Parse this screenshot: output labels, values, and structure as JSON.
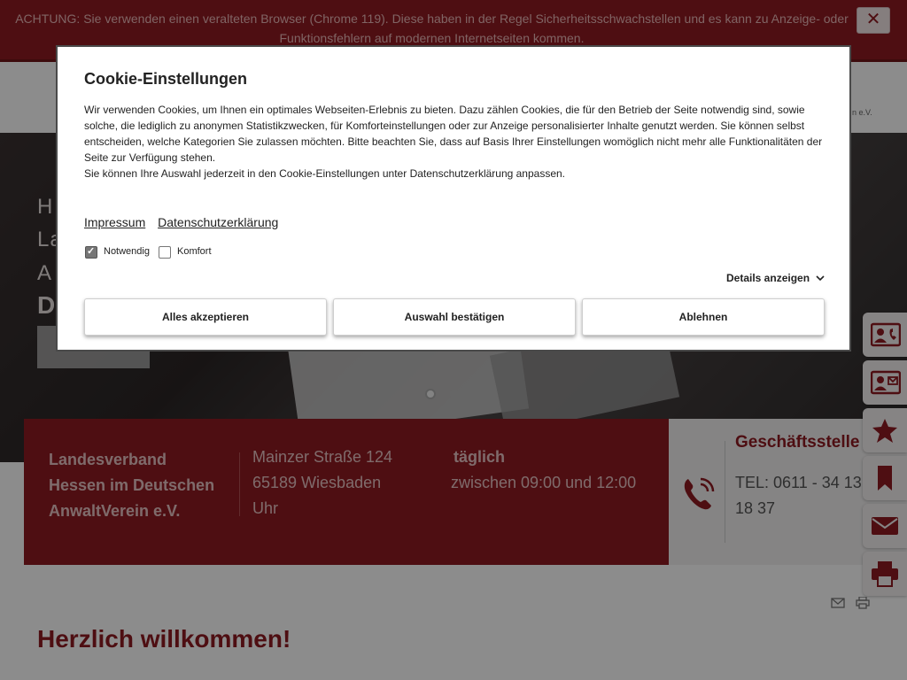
{
  "warning": {
    "text": "ACHTUNG: Sie verwenden einen veralteten Browser (Chrome 119). Diese haben in der Regel Sicherheitsschwachstellen und es kann zu Anzeige- oder Funktionsfehlern auf modernen Internetseiten kommen.",
    "close_label": "✕"
  },
  "header": {
    "logo_suffix": "n e.V."
  },
  "hero": {
    "lines": [
      "H",
      "La",
      "A",
      "D"
    ],
    "slider_dots": 3,
    "active_dot": 0
  },
  "info": {
    "org_lines": [
      "Landesverband",
      "Hessen im Deutschen",
      "AnwaltVerein e.V."
    ],
    "address_lines": [
      "Mainzer Straße 124",
      "65189 Wiesbaden"
    ],
    "hours_title": "täglich",
    "hours_lines": [
      "zwischen 09:00 und 12:00",
      "Uhr"
    ]
  },
  "contact": {
    "title": "Geschäftsstelle",
    "tel_lines": [
      "TEL: 0611 - 34 13",
      "18 37"
    ]
  },
  "rail": [
    {
      "icon": "phone-card-icon"
    },
    {
      "icon": "mail-card-icon"
    },
    {
      "icon": "star-icon"
    },
    {
      "icon": "bookmark-icon"
    },
    {
      "icon": "envelope-icon"
    },
    {
      "icon": "printer-icon"
    }
  ],
  "main": {
    "welcome": "Herzlich willkommen!"
  },
  "cookie": {
    "title": "Cookie-Einstellungen",
    "description": "Wir verwenden Cookies, um Ihnen ein optimales Webseiten-Erlebnis zu bieten. Dazu zählen Cookies, die für den Betrieb der Seite notwendig sind, sowie solche, die lediglich zu anonymen Statistikzwecken, für Komforteinstellungen oder zur Anzeige personalisierter Inhalte genutzt werden. Sie können selbst entscheiden, welche Kategorien Sie zulassen möchten. Bitte beachten Sie, dass auf Basis Ihrer Einstellungen womöglich nicht mehr alle Funktionalitäten der Seite zur Verfügung stehen.",
    "description2": "Sie können Ihre Auswahl jederzeit in den Cookie-Einstellungen unter Datenschutzerklärung anpassen.",
    "link_impressum": "Impressum",
    "link_privacy": "Datenschutzerklärung",
    "check_necessary": {
      "label": "Notwendig",
      "checked": true
    },
    "check_comfort": {
      "label": "Komfort",
      "checked": false
    },
    "details_label": "Details anzeigen",
    "btn_accept_all": "Alles akzeptieren",
    "btn_confirm": "Auswahl bestätigen",
    "btn_reject": "Ablehnen"
  },
  "colors": {
    "brand": "#8e1b21"
  }
}
